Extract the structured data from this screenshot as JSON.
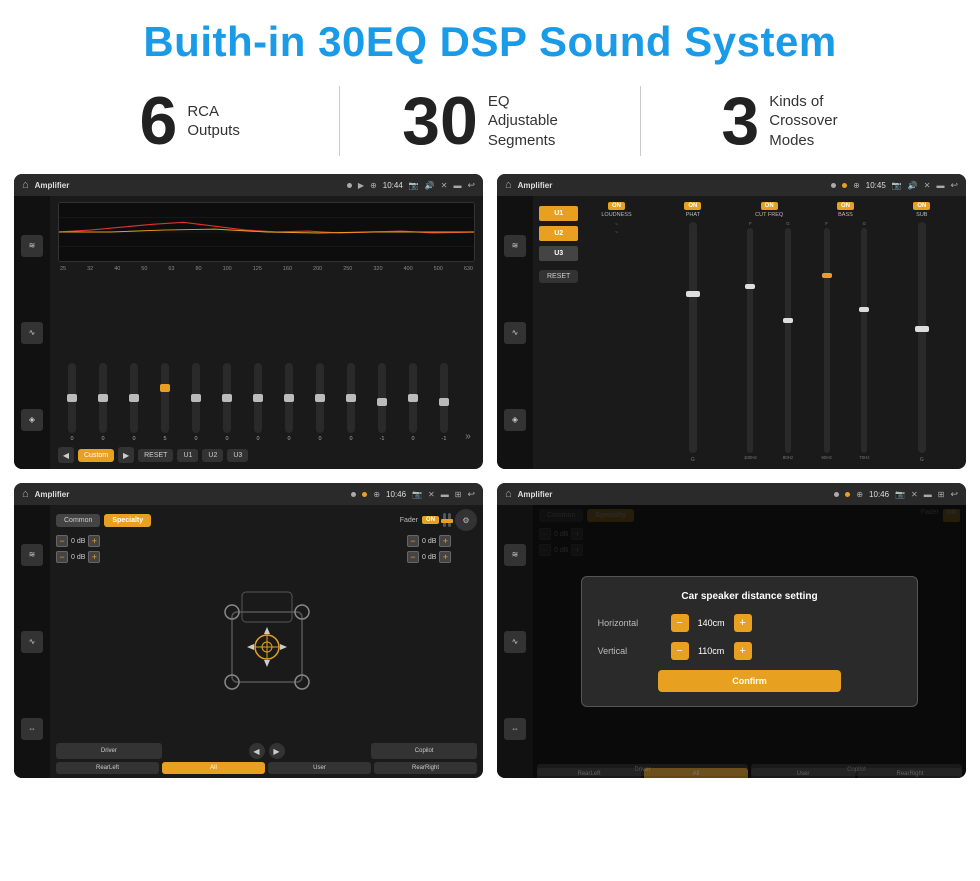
{
  "page": {
    "title": "Buith-in 30EQ DSP Sound System",
    "bg_color": "#ffffff"
  },
  "stats": [
    {
      "number": "6",
      "label": "RCA\nOutputs"
    },
    {
      "number": "30",
      "label": "EQ Adjustable\nSegments"
    },
    {
      "number": "3",
      "label": "Kinds of\nCrossover Modes"
    }
  ],
  "screens": [
    {
      "id": "eq-screen",
      "status_bar": {
        "title": "Amplifier",
        "time": "10:44"
      },
      "eq_freqs": [
        "25",
        "32",
        "40",
        "50",
        "63",
        "80",
        "100",
        "125",
        "160",
        "200",
        "250",
        "320",
        "400",
        "500",
        "630"
      ],
      "eq_values": [
        "0",
        "0",
        "0",
        "5",
        "0",
        "0",
        "0",
        "0",
        "0",
        "0",
        "0",
        "-1",
        "0",
        "-1"
      ],
      "preset": "Custom",
      "buttons": [
        "RESET",
        "U1",
        "U2",
        "U3"
      ]
    },
    {
      "id": "dsp-screen",
      "status_bar": {
        "title": "Amplifier",
        "time": "10:45"
      },
      "tabs": [
        "U1",
        "U2",
        "U3"
      ],
      "channels": [
        {
          "label": "LOUDNESS",
          "on": true
        },
        {
          "label": "PHAT",
          "on": true
        },
        {
          "label": "CUT FREQ",
          "on": true
        },
        {
          "label": "BASS",
          "on": true
        },
        {
          "label": "SUB",
          "on": true
        }
      ],
      "reset_label": "RESET"
    },
    {
      "id": "speaker-screen",
      "status_bar": {
        "title": "Amplifier",
        "time": "10:46"
      },
      "tabs": [
        "Common",
        "Specialty"
      ],
      "fader_label": "Fader",
      "fader_on": true,
      "levels": [
        {
          "value": "0 dB"
        },
        {
          "value": "0 dB"
        }
      ],
      "levels_right": [
        {
          "value": "0 dB"
        },
        {
          "value": "0 dB"
        }
      ],
      "bottom_btns": [
        "Driver",
        "",
        "",
        "Copilot",
        "RearLeft",
        "All",
        "User",
        "RearRight"
      ]
    },
    {
      "id": "distance-screen",
      "status_bar": {
        "title": "Amplifier",
        "time": "10:46"
      },
      "dialog": {
        "title": "Car speaker distance setting",
        "horizontal_label": "Horizontal",
        "horizontal_value": "140cm",
        "vertical_label": "Vertical",
        "vertical_value": "110cm",
        "confirm_label": "Confirm"
      },
      "bottom_btns": [
        "Driver",
        "Copilot",
        "RearLeft",
        "RearRight"
      ]
    }
  ],
  "icons": {
    "home": "⌂",
    "location": "📍",
    "speaker": "🔊",
    "back": "↩",
    "close": "✕",
    "window": "▬",
    "expand": "⊞",
    "play": "▶",
    "pause": "⏸",
    "rewind": "◀",
    "eq_icon": "≋",
    "wave_icon": "∿",
    "speaker_icon": "◈",
    "arrows_icon": "⇔"
  }
}
